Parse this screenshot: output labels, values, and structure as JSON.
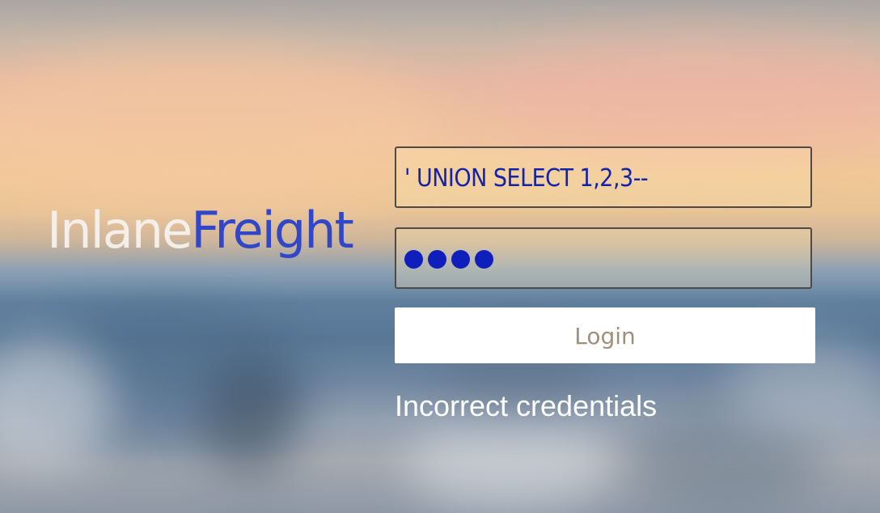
{
  "brand": {
    "part1": "Inlane",
    "part2": "Freight"
  },
  "form": {
    "username_value": "' UNION SELECT 1,2,3--",
    "password_mask_count": 4,
    "login_label": "Login"
  },
  "message": {
    "error_text": "Incorrect credentials"
  },
  "colors": {
    "brand_light": "#f6f2ef",
    "brand_blue": "#2f47c8",
    "input_text": "#1322a6",
    "button_text": "#a18f7c"
  }
}
